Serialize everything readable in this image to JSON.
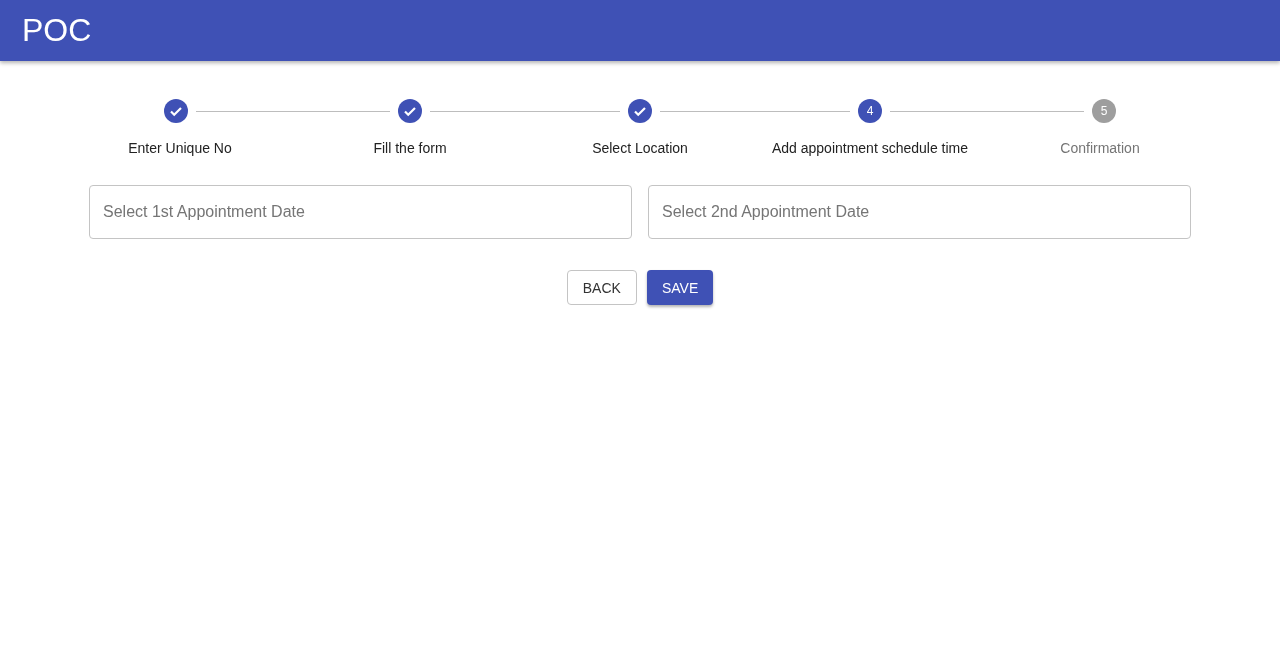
{
  "app_bar": {
    "title": "POC"
  },
  "stepper": {
    "steps": [
      {
        "label": "Enter Unique No",
        "kind": "completed"
      },
      {
        "label": "Fill the form",
        "kind": "completed"
      },
      {
        "label": "Select Location",
        "kind": "completed"
      },
      {
        "label": "Add appointment schedule time",
        "number": "4",
        "kind": "active"
      },
      {
        "label": "Confirmation",
        "number": "5",
        "kind": "pending"
      }
    ]
  },
  "fields": [
    {
      "placeholder": "Select 1st Appointment Date"
    },
    {
      "placeholder": "Select 2nd Appointment Date"
    }
  ],
  "buttons": [
    {
      "label": "BACK",
      "kind": "outlined"
    },
    {
      "label": "SAVE",
      "kind": "contained"
    }
  ]
}
